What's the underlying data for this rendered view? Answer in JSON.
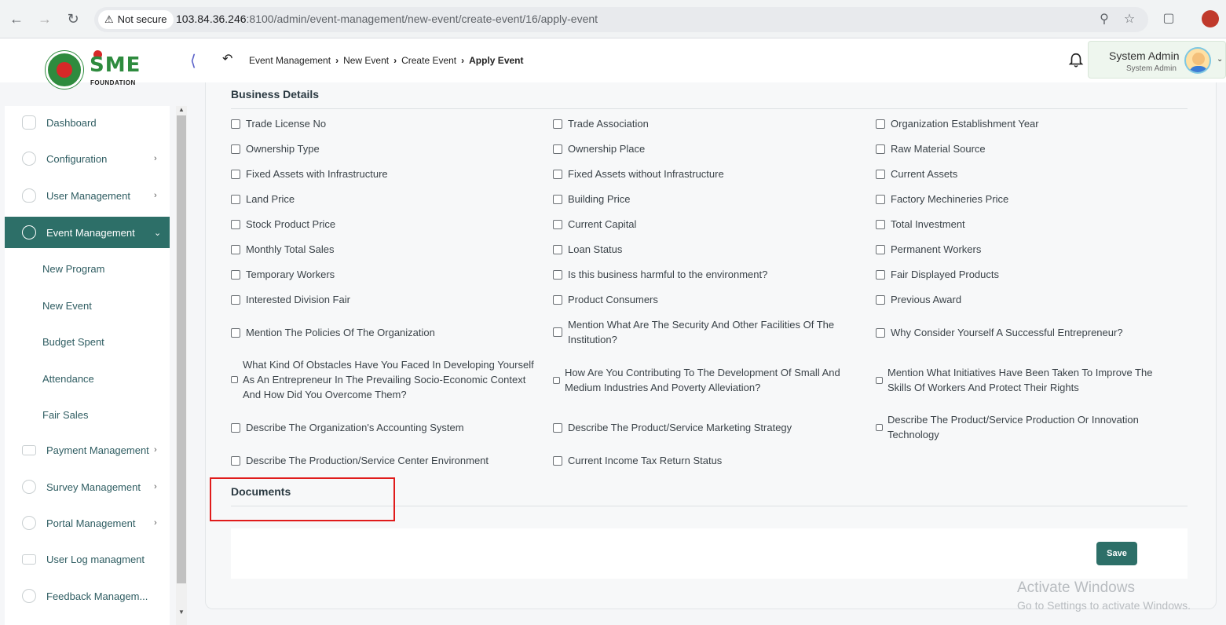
{
  "browser": {
    "secure_label": "Not secure",
    "url_host": "103.84.36.246",
    "url_path": ":8100/admin/event-management/new-event/create-event/16/apply-event",
    "icons": [
      "back-icon",
      "forward-icon",
      "reload-icon",
      "zoom-icon",
      "star-icon",
      "extensions-icon",
      "profile-icon"
    ]
  },
  "header": {
    "logo_text": "SME",
    "logo_subtext": "FOUNDATION",
    "breadcrumb": [
      "Event Management",
      "New Event",
      "Create Event",
      "Apply Event"
    ],
    "user_name": "System Admin",
    "user_role": "System Admin"
  },
  "sidebar": {
    "items": [
      {
        "label": "Dashboard",
        "icon": "dashboard-icon",
        "has_chevron": false
      },
      {
        "label": "Configuration",
        "icon": "config-icon",
        "has_chevron": true
      },
      {
        "label": "User Management",
        "icon": "user-shield-icon",
        "has_chevron": true
      },
      {
        "label": "Event Management",
        "icon": "lock-icon",
        "has_chevron": true,
        "active": true
      }
    ],
    "sub_items": [
      "New Program",
      "New Event",
      "Budget Spent",
      "Attendance",
      "Fair Sales"
    ],
    "items_after": [
      {
        "label": "Payment Management",
        "icon": "payment-icon",
        "has_chevron": true
      },
      {
        "label": "Survey Management",
        "icon": "survey-icon",
        "has_chevron": true
      },
      {
        "label": "Portal Management",
        "icon": "lock-icon",
        "has_chevron": true
      },
      {
        "label": "User Log managment",
        "icon": "log-icon",
        "has_chevron": false
      },
      {
        "label": "Feedback Managem...",
        "icon": "feedback-icon",
        "has_chevron": false
      }
    ],
    "active_color": "#2d6f68"
  },
  "business_details": {
    "title": "Business Details",
    "fields": [
      [
        "Trade License No",
        "Trade Association",
        "Organization Establishment Year"
      ],
      [
        "Ownership Type",
        "Ownership Place",
        "Raw Material Source"
      ],
      [
        "Fixed Assets with Infrastructure",
        "Fixed Assets without Infrastructure",
        "Current Assets"
      ],
      [
        "Land Price",
        "Building Price",
        "Factory Mechineries Price"
      ],
      [
        "Stock Product Price",
        "Current Capital",
        "Total Investment"
      ],
      [
        "Monthly Total Sales",
        "Loan Status",
        "Permanent Workers"
      ],
      [
        "Temporary Workers",
        "Is this business harmful to the environment?",
        "Fair Displayed Products"
      ],
      [
        "Interested Division Fair",
        "Product Consumers",
        "Previous Award"
      ],
      [
        "Mention The Policies Of The Organization",
        "Mention What Are The Security And Other Facilities Of The Institution?",
        "Why Consider Yourself A Successful Entrepreneur?"
      ],
      [
        "What Kind Of Obstacles Have You Faced In Developing Yourself As An Entrepreneur In The Prevailing Socio-Economic Context And How Did You Overcome Them?",
        "How Are You Contributing To The Development Of Small And Medium Industries And Poverty Alleviation?",
        "Mention What Initiatives Have Been Taken To Improve The Skills Of Workers And Protect Their Rights"
      ],
      [
        "Describe The Organization's Accounting System",
        "Describe The Product/Service Marketing Strategy",
        "Describe The Product/Service Production Or Innovation Technology"
      ],
      [
        "Describe The Production/Service Center Environment",
        "Current Income Tax Return Status"
      ]
    ]
  },
  "documents": {
    "title": "Documents"
  },
  "actions": {
    "save_label": "Save",
    "save_color": "#2d6f68"
  },
  "watermark": {
    "line1": "Activate Windows",
    "line2": "Go to Settings to activate Windows."
  },
  "highlight_color": "#e01b1b"
}
